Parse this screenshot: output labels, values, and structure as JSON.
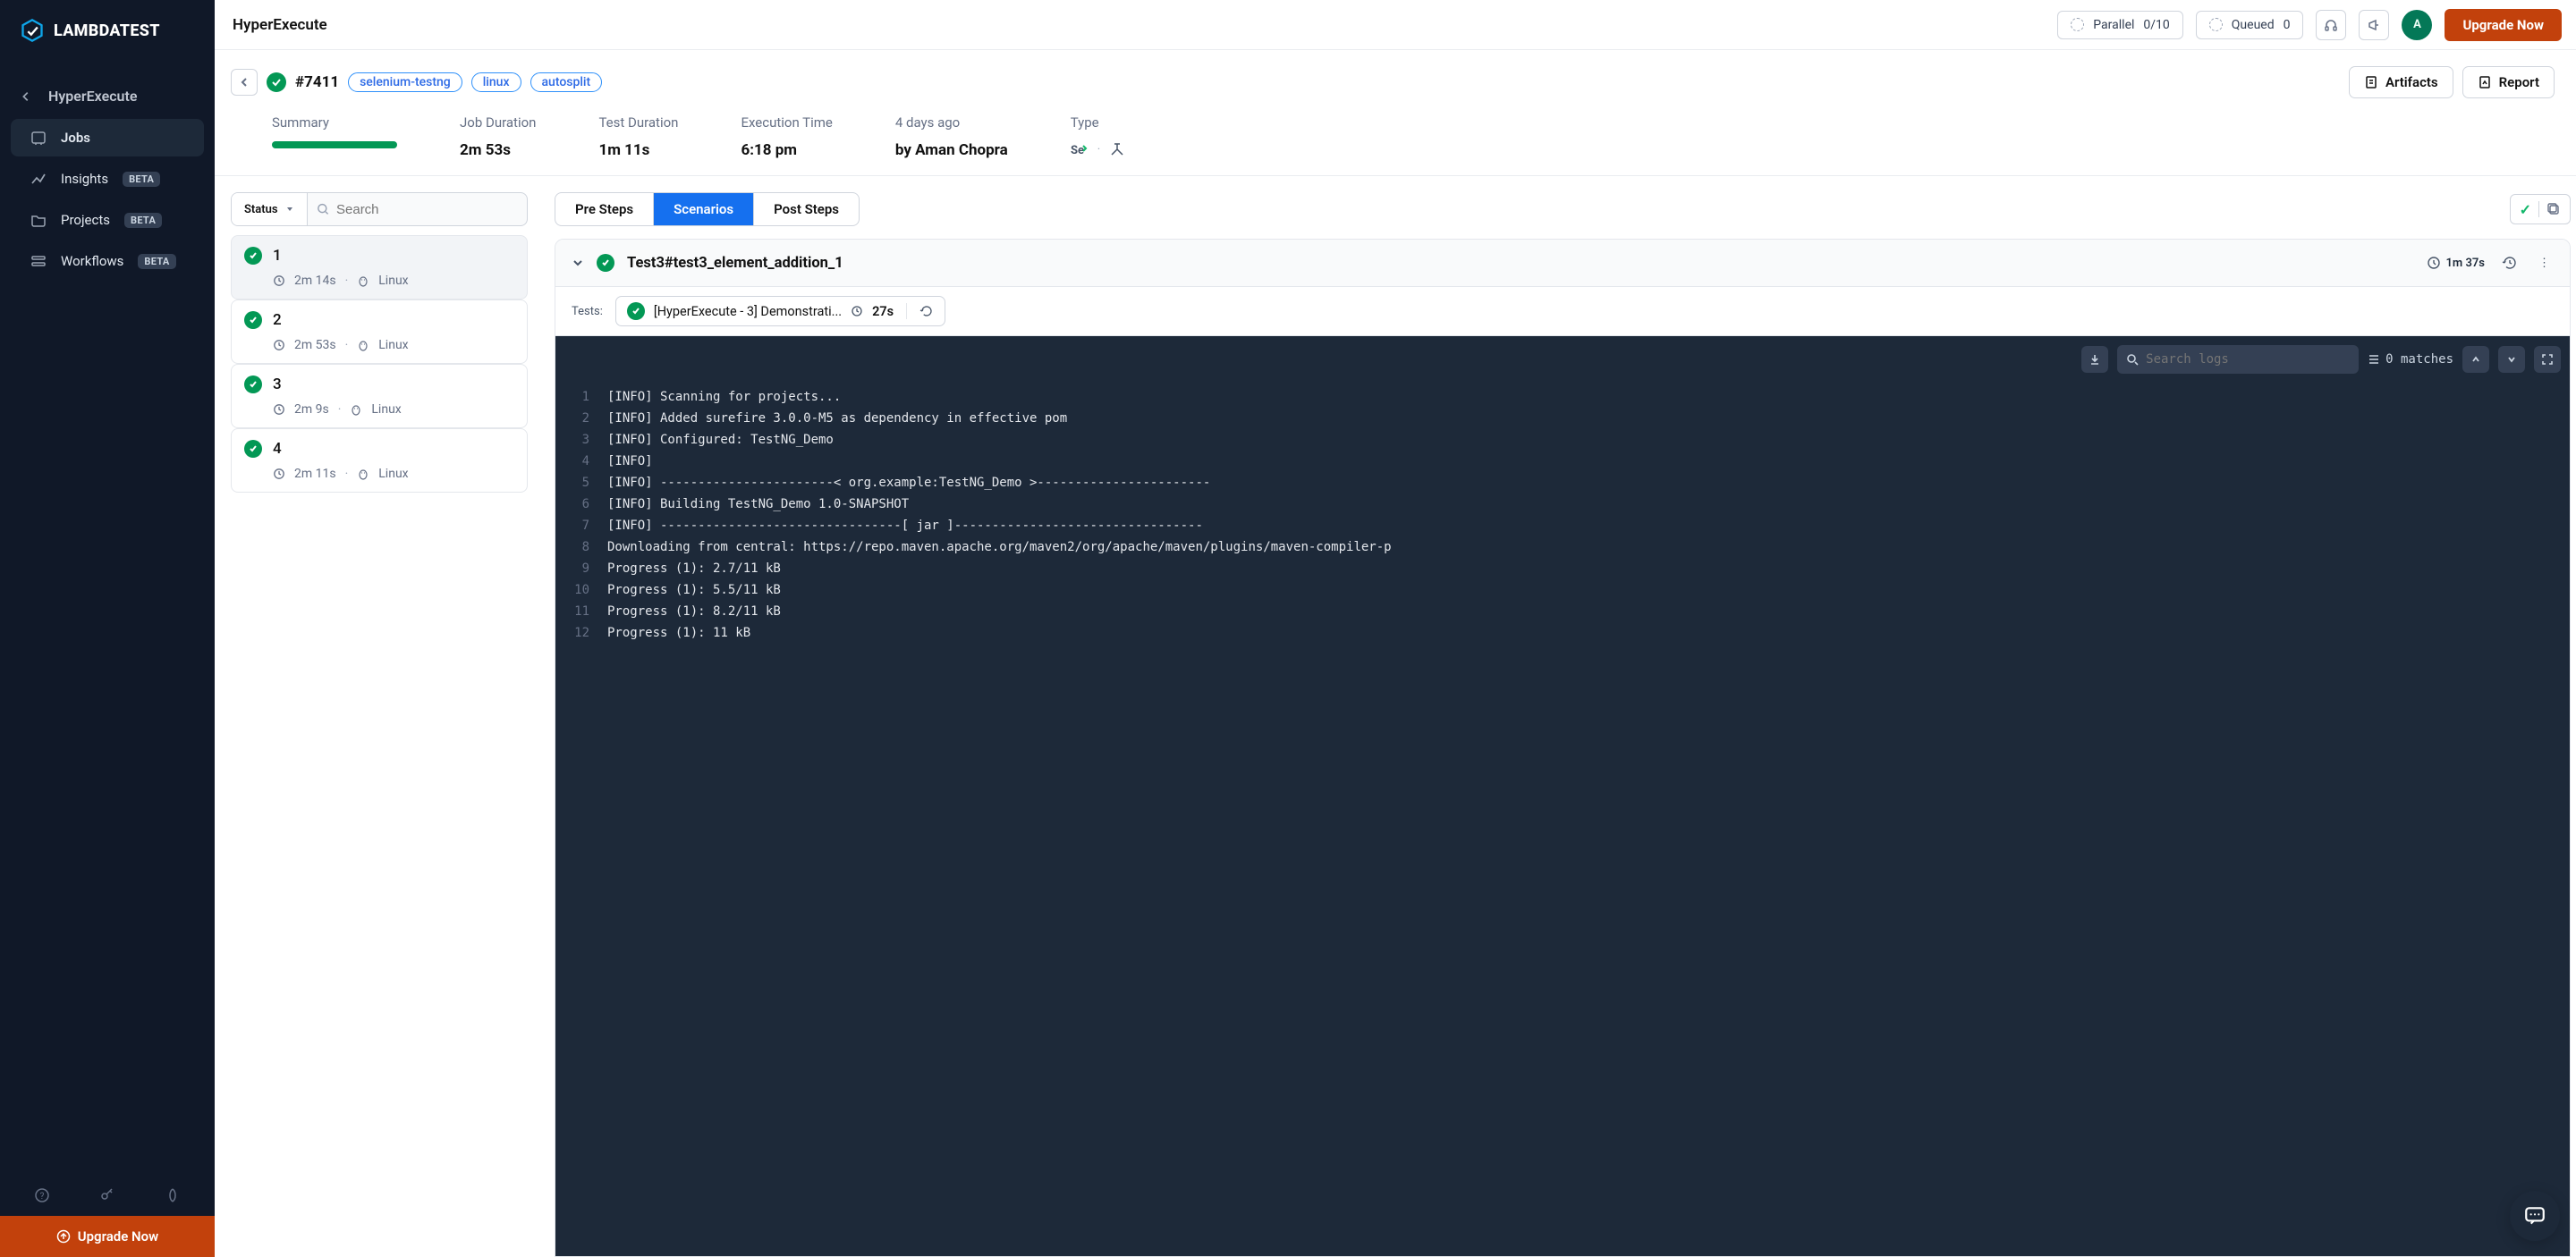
{
  "brand": "LAMBDATEST",
  "sidebar": {
    "back_label": "HyperExecute",
    "items": [
      {
        "label": "Jobs",
        "badge": null,
        "active": true
      },
      {
        "label": "Insights",
        "badge": "BETA",
        "active": false
      },
      {
        "label": "Projects",
        "badge": "BETA",
        "active": false
      },
      {
        "label": "Workflows",
        "badge": "BETA",
        "active": false
      }
    ],
    "upgrade": "Upgrade Now"
  },
  "topbar": {
    "page_title": "HyperExecute",
    "parallel_label": "Parallel",
    "parallel_value": "0/10",
    "queued_label": "Queued",
    "queued_value": "0",
    "avatar_initial": "A",
    "upgrade": "Upgrade Now"
  },
  "job": {
    "id": "#7411",
    "tags": [
      "selenium-testng",
      "linux",
      "autosplit"
    ],
    "artifacts_label": "Artifacts",
    "report_label": "Report",
    "stats": {
      "summary_label": "Summary",
      "job_duration_label": "Job Duration",
      "job_duration": "2m 53s",
      "test_duration_label": "Test Duration",
      "test_duration": "1m 11s",
      "exec_time_label": "Execution Time",
      "exec_time": "6:18 pm",
      "ago_label": "4 days ago",
      "by": "by Aman Chopra",
      "type_label": "Type"
    }
  },
  "left": {
    "status_label": "Status",
    "search_placeholder": "Search",
    "runs": [
      {
        "title": "1",
        "duration": "2m 14s",
        "os": "Linux",
        "selected": true
      },
      {
        "title": "2",
        "duration": "2m 53s",
        "os": "Linux",
        "selected": false
      },
      {
        "title": "3",
        "duration": "2m 9s",
        "os": "Linux",
        "selected": false
      },
      {
        "title": "4",
        "duration": "2m 11s",
        "os": "Linux",
        "selected": false
      }
    ]
  },
  "right": {
    "tabs": {
      "pre": "Pre Steps",
      "scenarios": "Scenarios",
      "post": "Post Steps"
    },
    "scenario_title": "Test3#test3_element_addition_1",
    "scenario_duration": "1m 37s",
    "tests_label": "Tests:",
    "test_chip": {
      "name": "[HyperExecute - 3] Demonstrati...",
      "duration": "27s"
    },
    "log_search_placeholder": "Search logs",
    "matches_label": "0 matches",
    "logs": [
      "[INFO] Scanning for projects...",
      "[INFO] Added surefire 3.0.0-M5 as dependency in effective pom",
      "[INFO] Configured: TestNG_Demo",
      "[INFO]",
      "[INFO] -----------------------< org.example:TestNG_Demo >-----------------------",
      "[INFO] Building TestNG_Demo 1.0-SNAPSHOT",
      "[INFO] --------------------------------[ jar ]---------------------------------",
      "Downloading from central: https://repo.maven.apache.org/maven2/org/apache/maven/plugins/maven-compiler-p",
      "Progress (1): 2.7/11 kB",
      "Progress (1): 5.5/11 kB",
      "Progress (1): 8.2/11 kB",
      "Progress (1): 11 kB"
    ]
  }
}
